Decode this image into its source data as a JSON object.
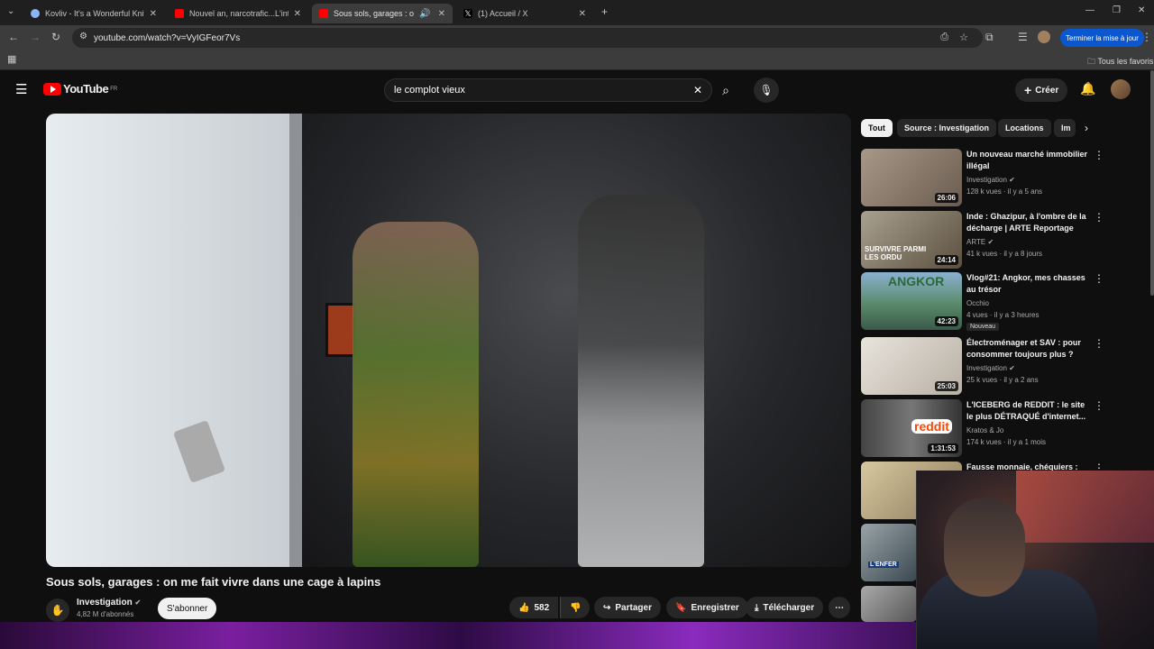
{
  "browser": {
    "tabs": [
      {
        "title": "Kovliv - It's a Wonderful Knife (",
        "favicon_color": "#8ab4f8"
      },
      {
        "title": "Nouvel an, narcotrafic...L'interv",
        "favicon_color": "#ff0000"
      },
      {
        "title": "Sous sols, garages : on me",
        "favicon_color": "#ff0000"
      },
      {
        "title": "(1) Accueil / X",
        "favicon_color": "#ffffff"
      }
    ],
    "url": "youtube.com/watch?v=VyIGFeor7Vs",
    "update_button": "Terminer la mise à jour",
    "bookmarks_label": "Tous les favoris"
  },
  "youtube": {
    "logo_text": "YouTube",
    "logo_country": "FR",
    "search_value": "le complot vieux",
    "create_label": "Créer",
    "video": {
      "title": "Sous sols, garages : on me fait vivre dans une cage à lapins",
      "channel": "Investigation",
      "subscribers": "4,82 M d'abonnés",
      "subscribe_label": "S'abonner",
      "likes": "582",
      "share_label": "Partager",
      "save_label": "Enregistrer",
      "download_label": "Télécharger"
    },
    "chips": [
      "Tout",
      "Source : Investigation",
      "Locations",
      "Im"
    ],
    "recommendations": [
      {
        "title": "Un nouveau marché immobilier illégal",
        "channel": "Investigation",
        "meta": "128 k vues · il y a 5 ans",
        "duration": "26:06",
        "thumb_color": "#8f8478"
      },
      {
        "title": "Inde : Ghazipur, à l'ombre de la décharge | ARTE Reportage",
        "channel": "ARTE",
        "meta": "41 k vues · il y a 8 jours",
        "duration": "24:14",
        "thumb_color": "#8a7d6a",
        "thumb_text": "SURVIVRE PARMI LES ORDU"
      },
      {
        "title": "Vlog#21: Angkor, mes chasses au trésor",
        "channel": "Occhio",
        "meta": "4 vues · il y a 3 heures",
        "duration": "42:23",
        "badge": "Nouveau",
        "thumb_color": "#4a7a5a",
        "thumb_text": "ANGKOR"
      },
      {
        "title": "Électroménager et SAV : pour consommer toujours plus ?",
        "channel": "Investigation",
        "meta": "25 k vues · il y a 2 ans",
        "duration": "25:03",
        "thumb_color": "#c8c2b8"
      },
      {
        "title": "L'ICEBERG de REDDIT : le site le plus DÉTRAQUÉ d'internet...",
        "channel": "Kratos & Jo",
        "meta": "174 k vues · il y a 1 mois",
        "duration": "1:31:53",
        "thumb_color": "#555555",
        "thumb_text": "reddit"
      },
      {
        "title": "Fausse monnaie, chéquiers :",
        "channel": "",
        "meta": "",
        "duration": "",
        "thumb_color": "#b89a6a"
      }
    ]
  }
}
